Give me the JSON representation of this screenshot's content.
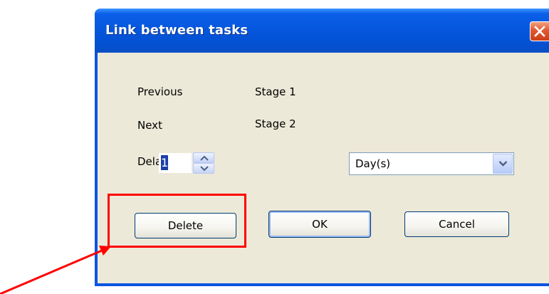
{
  "dialog": {
    "title": "Link between tasks"
  },
  "fields": {
    "previous_label": "Previous",
    "previous_value": "Stage 1",
    "next_label": "Next",
    "next_value": "Stage 2",
    "delay_label": "Delay",
    "delay_value": "1",
    "delay_unit": "Day(s)"
  },
  "buttons": {
    "delete": "Delete",
    "ok": "OK",
    "cancel": "Cancel"
  },
  "annotation": {
    "highlight_color": "#ff0000",
    "target": "delete-button"
  },
  "colors": {
    "titlebar": "#0556dc",
    "client": "#ece9d8",
    "close": "#e0582f"
  },
  "icons": {
    "close": "close-icon",
    "spin_up": "chevron-up-icon",
    "spin_down": "chevron-down-icon",
    "combo": "chevron-down-icon"
  }
}
